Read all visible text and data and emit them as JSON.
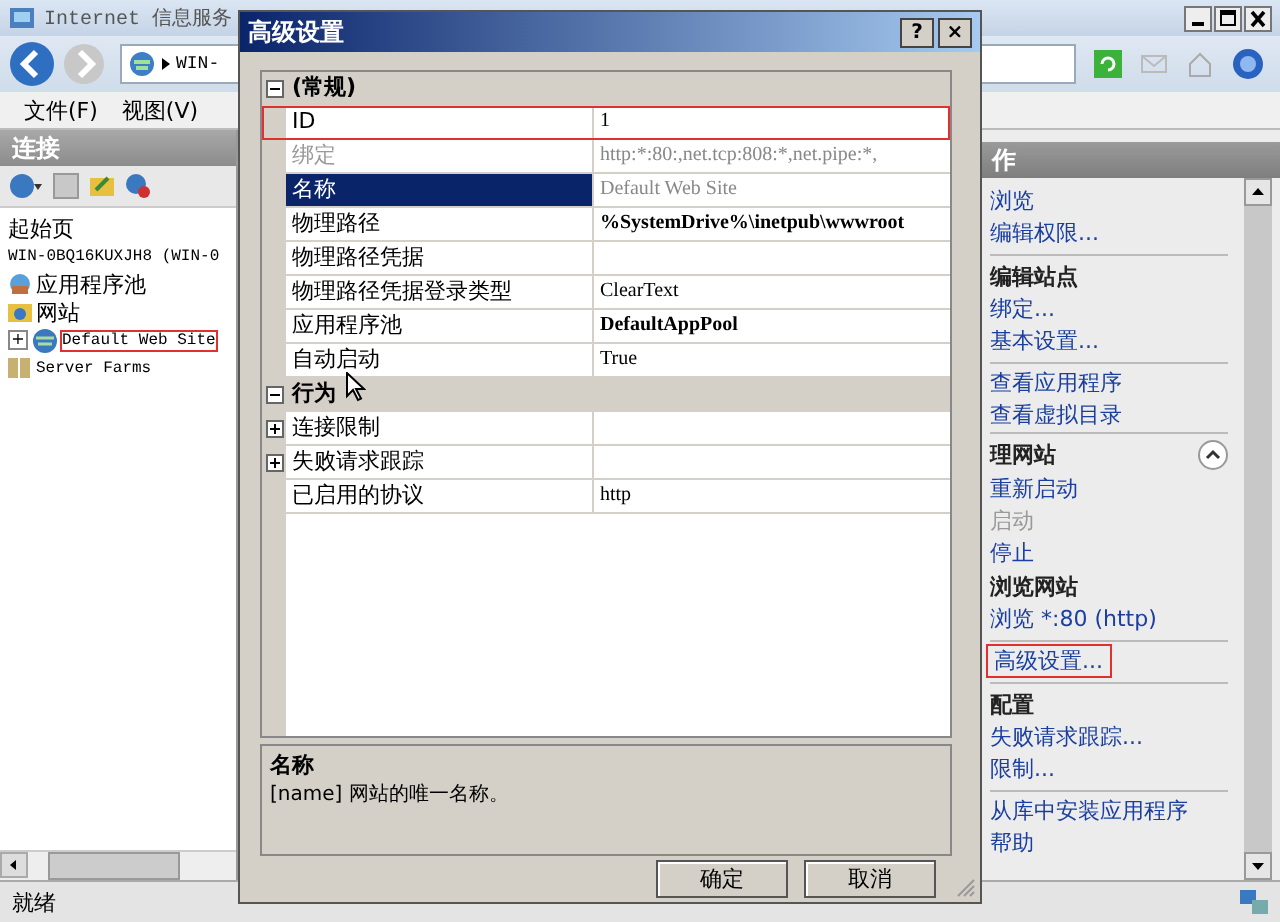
{
  "window": {
    "title": "Internet 信息服务"
  },
  "address": {
    "path": "WIN-"
  },
  "menu": [
    "文件(F)",
    "视图(V)"
  ],
  "connections": {
    "title": "连接",
    "items": [
      {
        "label": "起始页",
        "kind": "page",
        "highlighted": false
      },
      {
        "label": "WIN-0BQ16KUXJH8 (WIN-0",
        "kind": "server",
        "highlighted": false
      },
      {
        "label": "应用程序池",
        "kind": "pool",
        "highlighted": false
      },
      {
        "label": "网站",
        "kind": "sites",
        "highlighted": false
      },
      {
        "label": "Default Web Site",
        "kind": "site",
        "expander": "+",
        "highlighted": true
      },
      {
        "label": "Server Farms",
        "kind": "farm",
        "highlighted": false
      }
    ]
  },
  "actions": {
    "title": "作",
    "items": [
      {
        "kind": "link",
        "label": "浏览",
        "highlighted": false
      },
      {
        "kind": "link",
        "label": "编辑权限...",
        "highlighted": false
      },
      {
        "kind": "divider"
      },
      {
        "kind": "heading",
        "label": "编辑站点"
      },
      {
        "kind": "link",
        "label": "绑定...",
        "highlighted": false
      },
      {
        "kind": "link",
        "label": "基本设置...",
        "highlighted": false
      },
      {
        "kind": "divider"
      },
      {
        "kind": "link",
        "label": "查看应用程序",
        "highlighted": false
      },
      {
        "kind": "link",
        "label": "查看虚拟目录",
        "highlighted": false
      },
      {
        "kind": "section",
        "label": "理网站",
        "expanded": true
      },
      {
        "kind": "link",
        "label": "重新启动",
        "highlighted": false
      },
      {
        "kind": "disabled",
        "label": "启动"
      },
      {
        "kind": "link",
        "label": "停止",
        "highlighted": false
      },
      {
        "kind": "heading",
        "label": "浏览网站"
      },
      {
        "kind": "link",
        "label": "浏览 *:80 (http)",
        "highlighted": false
      },
      {
        "kind": "divider"
      },
      {
        "kind": "link",
        "label": "高级设置...",
        "highlighted": true
      },
      {
        "kind": "divider"
      },
      {
        "kind": "heading",
        "label": "配置"
      },
      {
        "kind": "link",
        "label": "失败请求跟踪...",
        "highlighted": false
      },
      {
        "kind": "link",
        "label": "限制...",
        "highlighted": false
      },
      {
        "kind": "divider"
      },
      {
        "kind": "link",
        "label": "从库中安装应用程序",
        "highlighted": false
      },
      {
        "kind": "link",
        "label": "帮助",
        "highlighted": false
      }
    ]
  },
  "status_bar": "就绪",
  "dialog": {
    "title": "高级设置",
    "help": "?",
    "close": "×",
    "categories": [
      {
        "name": "(常规)",
        "expanded": true,
        "rows": [
          {
            "name": "ID",
            "value": "1",
            "selected": false,
            "readonly": false,
            "bold": false,
            "highlighted": true
          },
          {
            "name": "绑定",
            "value": "http:*:80:,net.tcp:808:*,net.pipe:*,",
            "selected": false,
            "readonly": true,
            "bold": false,
            "highlighted": false
          },
          {
            "name": "名称",
            "value": "Default Web Site",
            "selected": true,
            "readonly": true,
            "bold": false,
            "highlighted": false
          },
          {
            "name": "物理路径",
            "value": "%SystemDrive%\\inetpub\\wwwroot",
            "selected": false,
            "readonly": false,
            "bold": true,
            "highlighted": false
          },
          {
            "name": "物理路径凭据",
            "selected": false,
            "readonly": false,
            "highlighted": false
          },
          {
            "name": "物理路径凭据登录类型",
            "value": "ClearText",
            "selected": false,
            "readonly": false,
            "bold": false,
            "highlighted": false
          },
          {
            "name": "应用程序池",
            "value": "DefaultAppPool",
            "selected": false,
            "readonly": false,
            "bold": true,
            "highlighted": false
          },
          {
            "name": "自动启动",
            "value": "True",
            "selected": false,
            "readonly": false,
            "bold": false,
            "highlighted": false
          }
        ]
      },
      {
        "name": "行为",
        "expanded": true,
        "rows": [
          {
            "name": "连接限制",
            "expandable": true,
            "selected": false,
            "readonly": false,
            "highlighted": false
          },
          {
            "name": "失败请求跟踪",
            "expandable": true,
            "selected": false,
            "readonly": false,
            "highlighted": false
          },
          {
            "name": "已启用的协议",
            "value": "http",
            "selected": false,
            "readonly": false,
            "bold": false,
            "highlighted": false
          }
        ]
      }
    ],
    "description": {
      "title": "名称",
      "text": "[name] 网站的唯一名称。"
    },
    "buttons": [
      "确定",
      "取消"
    ]
  }
}
